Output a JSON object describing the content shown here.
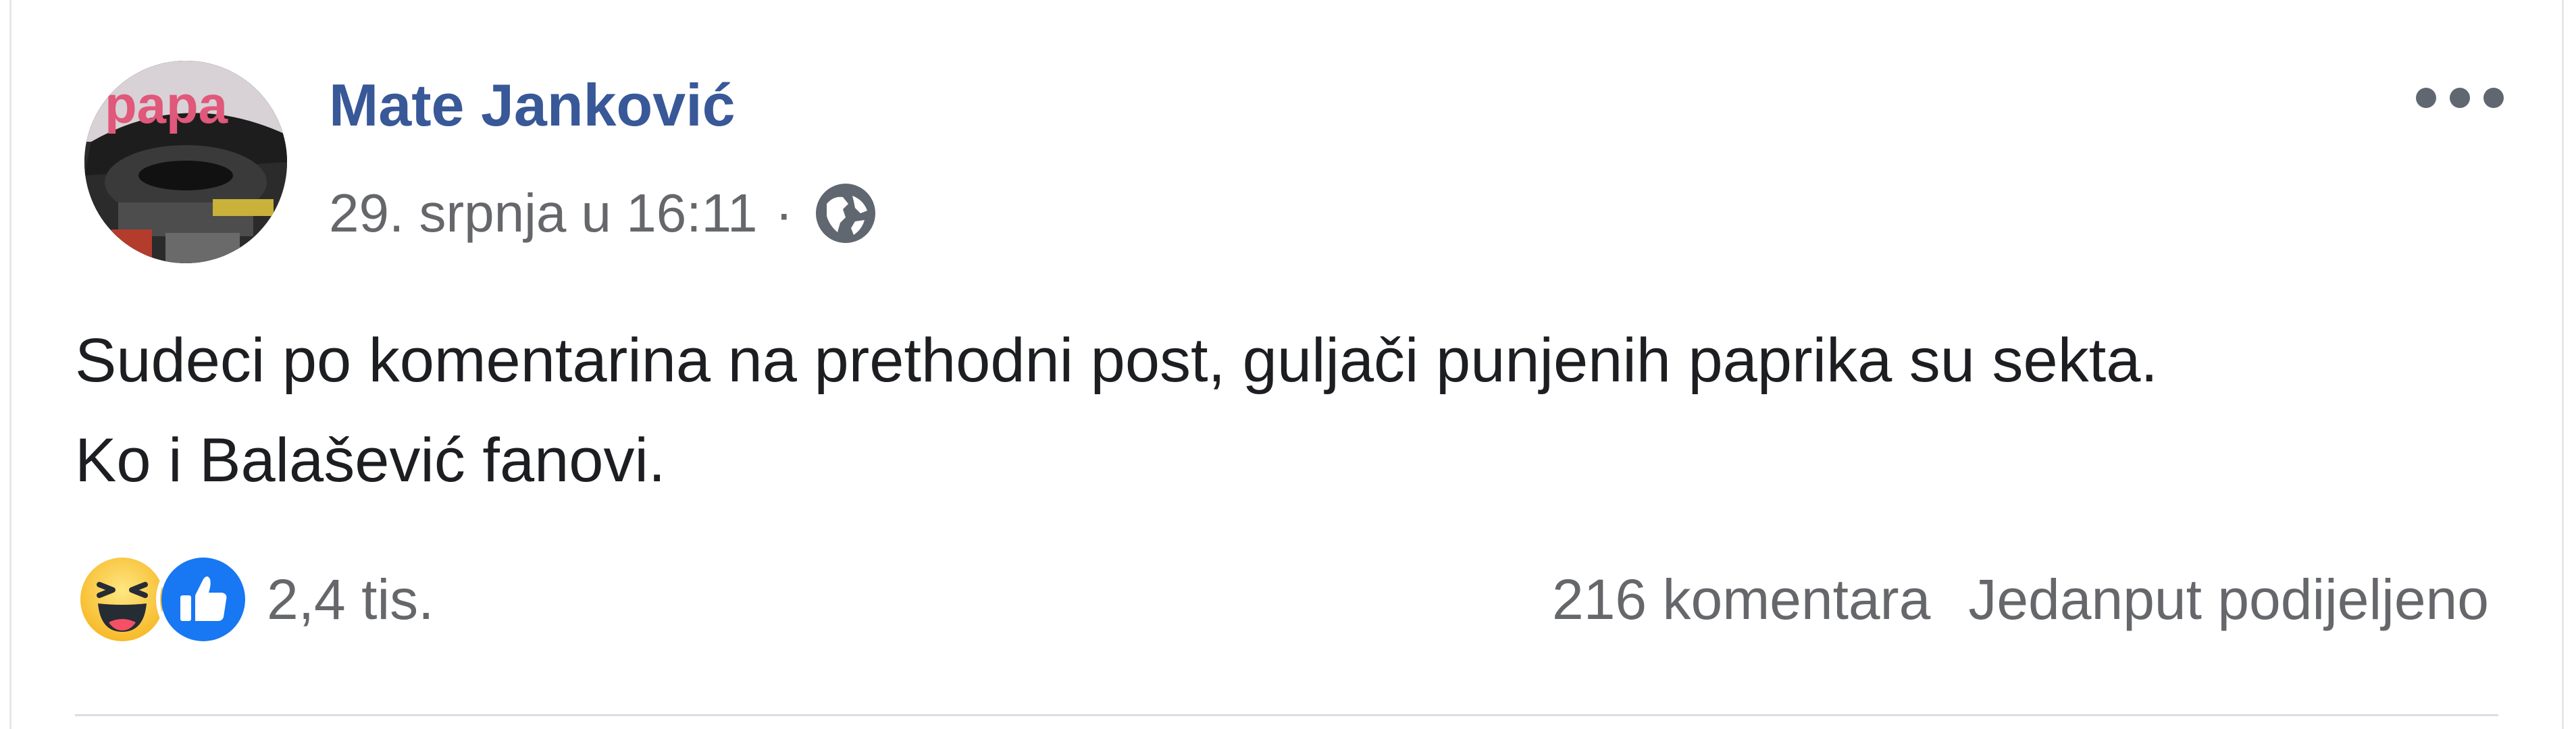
{
  "post": {
    "author": "Mate Janković",
    "timestamp": "29. srpnja u 16:11",
    "separator": "·",
    "privacy_icon": "globe-icon",
    "text_lines": [
      "Sudeci po komentarina na prethodni post, guljači punjenih paprika su sekta.",
      "Ko i Balašević fanovi."
    ],
    "reactions": {
      "icons": [
        "haha-icon",
        "like-icon"
      ],
      "count": "2,4 tis."
    },
    "comments": "216 komentara",
    "shares": "Jedanput podijeljeno"
  },
  "colors": {
    "author_link": "#385898",
    "secondary_text": "#65676b",
    "body_text": "#1c1e21",
    "like_blue": "#1877f2",
    "haha_yellow": "#f7b928"
  }
}
